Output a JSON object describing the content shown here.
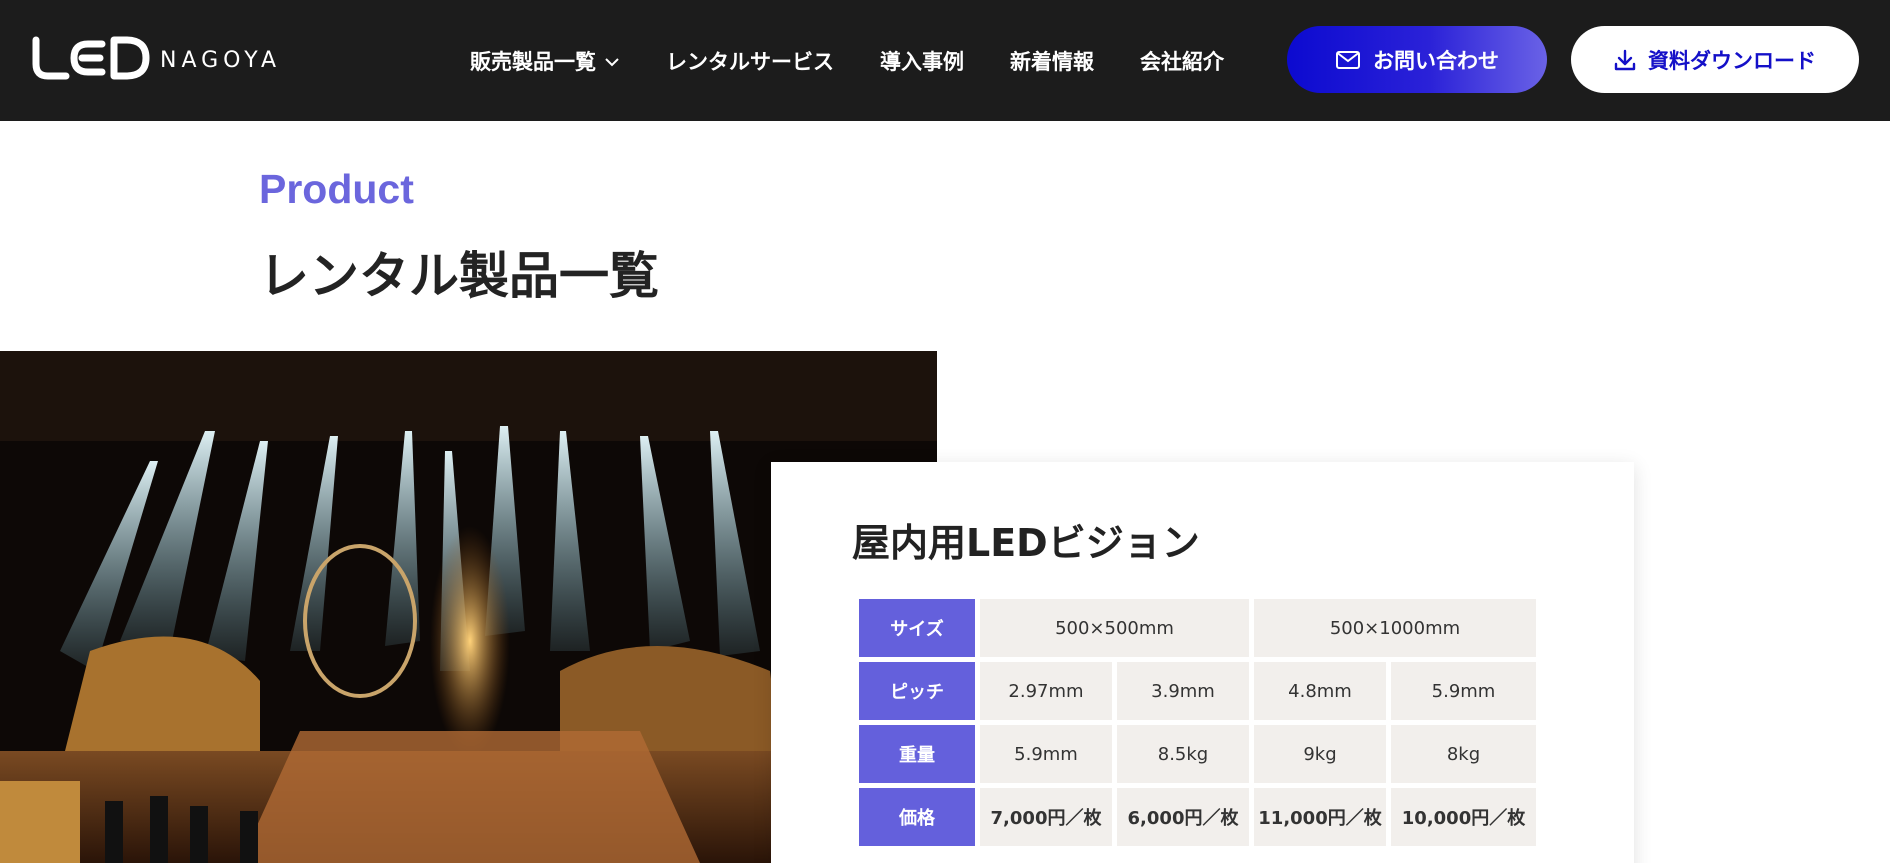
{
  "header": {
    "logo_text": "LED",
    "logo_sub": "NAGOYA",
    "nav": [
      {
        "label": "販売製品一覧",
        "has_dropdown": true
      },
      {
        "label": "レンタルサービス"
      },
      {
        "label": "導入事例"
      },
      {
        "label": "新着情報"
      },
      {
        "label": "会社紹介"
      }
    ],
    "contact_label": "お問い合わせ",
    "contact_icon": "mail-icon",
    "download_label": "資料ダウンロード",
    "download_icon": "download-icon"
  },
  "section": {
    "eyebrow": "Product",
    "title": "レンタル製品一覧"
  },
  "card": {
    "title": "屋内用LEDビジョン",
    "table": {
      "size_label": "サイズ",
      "sizes": [
        "500×500mm",
        "500×1000mm"
      ],
      "pitch_label": "ピッチ",
      "pitches": [
        "2.97mm",
        "3.9mm",
        "4.8mm",
        "5.9mm"
      ],
      "weight_label": "重量",
      "weights": [
        "5.9mm",
        "8.5kg",
        "9kg",
        "8kg"
      ],
      "price_label": "価格",
      "prices": [
        "7,000円／枚",
        "6,000円／枚",
        "11,000円／枚",
        "10,000円／枚"
      ]
    }
  },
  "colors": {
    "header_bg": "#1c1c1c",
    "accent": "#6460dc",
    "contact_gradient_start": "#0c0ad0",
    "contact_gradient_end": "#6a62e6",
    "download_text": "#1410c8",
    "cell_bg": "#f2efec"
  }
}
